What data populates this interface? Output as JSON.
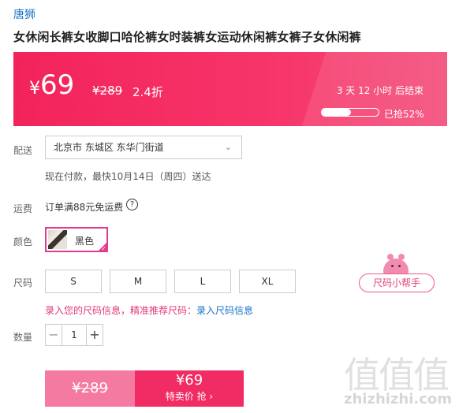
{
  "brand": "唐狮",
  "product_title": "女休闲长裤女收脚口哈伦裤女时装裤女运动休闲裤女裤子女休闲裤",
  "banner": {
    "currency": "¥",
    "price": "69",
    "original_price": "¥289",
    "discount": "2.4折",
    "countdown": "3 天 12 小时 后结束",
    "sold_progress": 0.52,
    "sold_label": "已抢52%"
  },
  "delivery": {
    "label": "配送",
    "address": "北京市 东城区 东华门街道",
    "note": "现在付款，最快10月14日（周四）送达"
  },
  "freight": {
    "label": "运费",
    "text": "订单满88元免运费",
    "help_icon": "?"
  },
  "color": {
    "label": "颜色",
    "selected": "黑色"
  },
  "size": {
    "label": "尺码",
    "options": [
      "S",
      "M",
      "L",
      "XL"
    ],
    "helper": "尺码小帮手",
    "note_prefix": "录入您的尺码信息，精准推荐尺码：",
    "note_link": "录入尺码信息"
  },
  "quantity": {
    "label": "数量",
    "value": "1",
    "minus": "−",
    "plus": "+"
  },
  "buy": {
    "original_price": "¥289",
    "price": "¥69",
    "action": "特卖价 抢 ›"
  },
  "watermark": {
    "logo": "值值值",
    "url": "zhizhizhi.com"
  }
}
